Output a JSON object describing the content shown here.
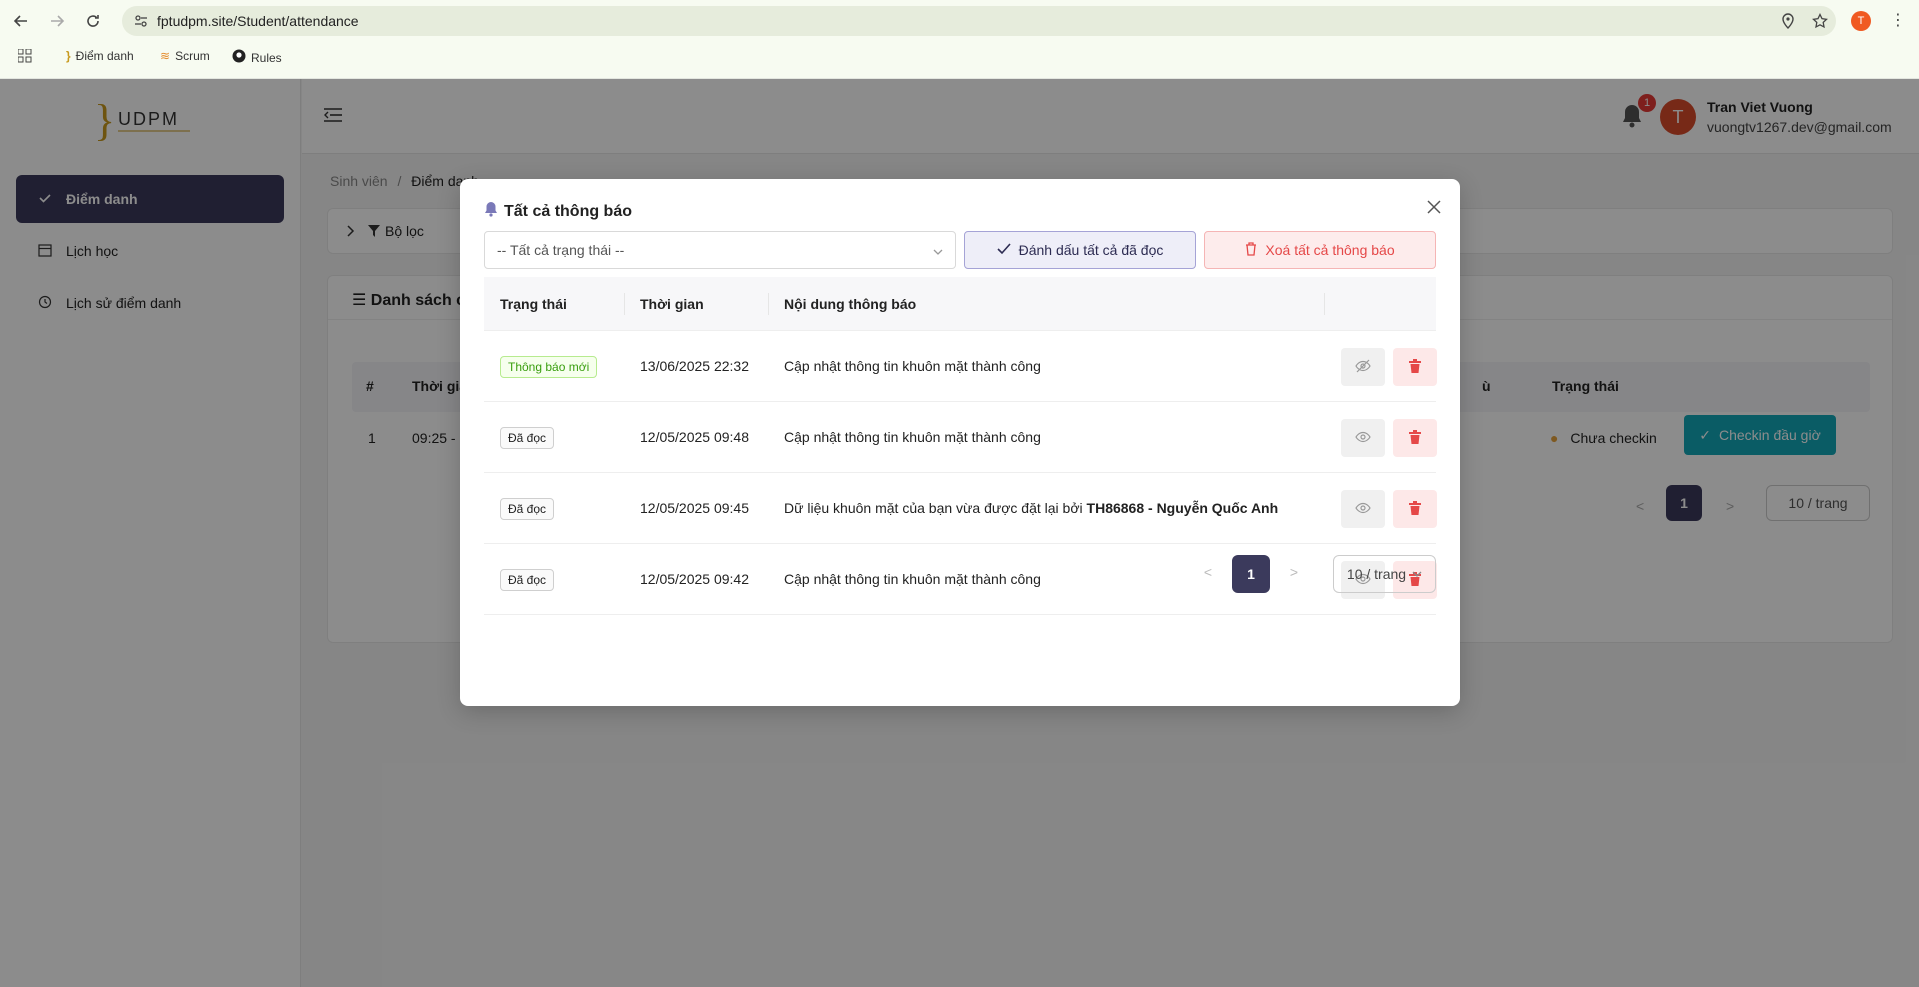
{
  "browser": {
    "url": "fptudpm.site/Student/attendance",
    "profile_initial": "T",
    "bookmarks": [
      {
        "label": "Điểm danh"
      },
      {
        "label": "Scrum"
      },
      {
        "label": "Rules"
      }
    ]
  },
  "sidebar": {
    "items": [
      {
        "label": "Điểm danh",
        "icon": "check-icon",
        "active": true
      },
      {
        "label": "Lịch học",
        "icon": "calendar-icon",
        "active": false
      },
      {
        "label": "Lịch sử điểm danh",
        "icon": "history-icon",
        "active": false
      }
    ]
  },
  "header": {
    "notification_count": "1",
    "avatar_initial": "T",
    "user_name": "Tran Viet Vuong",
    "user_email": "vuongtv1267.dev@gmail.com"
  },
  "breadcrumb": {
    "root": "Sinh viên",
    "separator": "/",
    "current": "Điểm danh"
  },
  "filter": {
    "label": "Bộ lọc"
  },
  "attendance_list": {
    "title": "Danh sách c",
    "columns": [
      "#",
      "Thời gia",
      "ù",
      "Trạng thái"
    ],
    "row": {
      "index": "1",
      "time": "09:25 -",
      "status": "Chưa checkin",
      "action": "Checkin đầu giờ"
    },
    "page": "1",
    "page_size": "10 / trang"
  },
  "modal": {
    "title": "Tất cả thông báo",
    "status_filter_placeholder": "-- Tất cả trạng thái --",
    "mark_all_read_label": "Đánh dấu tất cả đã đọc",
    "delete_all_label": "Xoá tất cả thông báo",
    "columns": {
      "status": "Trạng thái",
      "time": "Thời gian",
      "content": "Nội dung thông báo"
    },
    "rows": [
      {
        "status": "Thông báo mới",
        "status_type": "new",
        "time": "13/06/2025 22:32",
        "content": "Cập nhật thông tin khuôn mặt thành công",
        "content_bold": ""
      },
      {
        "status": "Đã đọc",
        "status_type": "read",
        "time": "12/05/2025 09:48",
        "content": "Cập nhật thông tin khuôn mặt thành công",
        "content_bold": ""
      },
      {
        "status": "Đã đọc",
        "status_type": "read",
        "time": "12/05/2025 09:45",
        "content": "Dữ liệu khuôn mặt của bạn vừa được đặt lại bởi ",
        "content_bold": "TH86868 - Nguyễn Quốc Anh"
      },
      {
        "status": "Đã đọc",
        "status_type": "read",
        "time": "12/05/2025 09:42",
        "content": "Cập nhật thông tin khuôn mặt thành công",
        "content_bold": ""
      }
    ],
    "pagination": {
      "prev": "<",
      "current_page": "1",
      "next": ">",
      "page_size": "10 / trang"
    }
  },
  "colors": {
    "primary": "#3b3a5c",
    "danger": "#e54848",
    "success_tag": "#389e0d",
    "checkin": "#13a8b8"
  }
}
